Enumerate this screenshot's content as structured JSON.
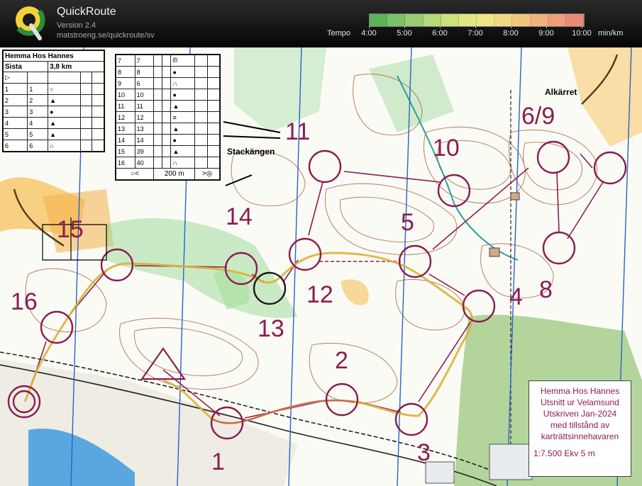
{
  "app": {
    "title": "QuickRoute",
    "version": "Version 2.4",
    "url": "matstroeng.se/quickroute/sv"
  },
  "tempo": {
    "label": "Tempo",
    "unit": "min/km",
    "ticks": [
      "4:00",
      "5:00",
      "6:00",
      "7:00",
      "8:00",
      "9:00",
      "10:00"
    ],
    "colors": [
      "#5db35a",
      "#7cc06a",
      "#9bcc72",
      "#b6d77a",
      "#cfe07f",
      "#e2e683",
      "#eee686",
      "#f2d884",
      "#f2c680",
      "#f0b27d",
      "#ee9e7a",
      "#ec8a78"
    ]
  },
  "map": {
    "legend": {
      "event": "Hemma Hos Hannes",
      "class": "Sista",
      "length": "3,8 km",
      "rows_left": [
        {
          "n": "1",
          "code": "1",
          "sym": "○"
        },
        {
          "n": "2",
          "code": "2",
          "sym": "▲"
        },
        {
          "n": "3",
          "code": "3",
          "sym": "●"
        },
        {
          "n": "4",
          "code": "4",
          "sym": "▲"
        },
        {
          "n": "5",
          "code": "5",
          "sym": "▲"
        },
        {
          "n": "6",
          "code": "6",
          "sym": "∩"
        }
      ],
      "rows_right": [
        {
          "n": "7",
          "code": "7",
          "sym": "ᗰ"
        },
        {
          "n": "8",
          "code": "8",
          "sym": "●"
        },
        {
          "n": "9",
          "code": "6",
          "sym": "∩"
        },
        {
          "n": "10",
          "code": "10",
          "sym": "●"
        },
        {
          "n": "11",
          "code": "11",
          "sym": "▲"
        },
        {
          "n": "12",
          "code": "12",
          "sym": "≡"
        },
        {
          "n": "13",
          "code": "13",
          "sym": "▲"
        },
        {
          "n": "14",
          "code": "14",
          "sym": "●"
        },
        {
          "n": "15",
          "code": "39",
          "sym": "▲"
        },
        {
          "n": "16",
          "code": "40",
          "sym": "∩"
        }
      ],
      "finish_text": "200 m"
    },
    "controls": [
      "1",
      "2",
      "3",
      "4",
      "5",
      "6/9",
      "8",
      "10",
      "11",
      "12",
      "13",
      "14",
      "15",
      "16"
    ],
    "places": {
      "alkarret": "Alkärret",
      "stackangen": "Stackängen"
    },
    "credit": {
      "line1": "Hemma Hos Hannes",
      "line2": "Utsnitt ur Velamsund",
      "line3": "Utskriven Jan-2024",
      "line4": "med tillstånd av",
      "line5": "karträttsinnehavaren",
      "scale": "1:7.500  Ekv 5 m"
    }
  }
}
